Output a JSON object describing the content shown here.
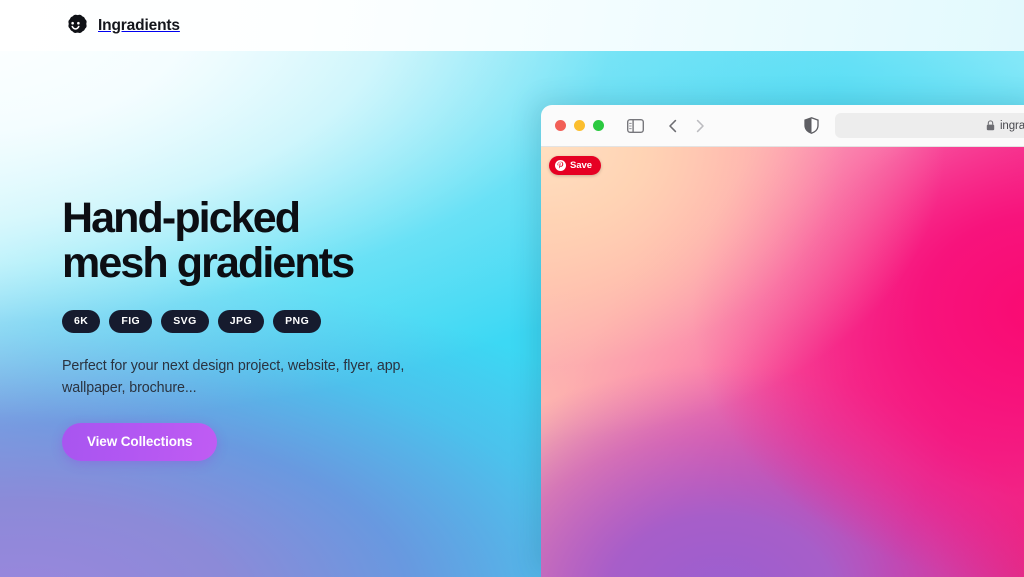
{
  "navbar": {
    "brand_name": "Ingradients",
    "logo_icon": "scalloped-square-smiley-logo"
  },
  "hero": {
    "title_line1": "Hand-picked",
    "title_line2": "mesh gradients",
    "badges": [
      "6K",
      "FIG",
      "SVG",
      "JPG",
      "PNG"
    ],
    "subtitle": "Perfect for your next design project, website, flyer, app, wallpaper, brochure...",
    "cta_label": "View Collections"
  },
  "browser": {
    "traffic_lights": {
      "close": "close-window-light",
      "minimize": "minimize-window-light",
      "zoom": "zoom-window-light"
    },
    "sidebar_toggle_icon": "sidebar-toggle-icon",
    "back_icon": "chevron-left-icon",
    "forward_icon": "chevron-right-icon",
    "shield_icon": "privacy-shield-icon",
    "address_bar": {
      "lock_icon": "lock-icon",
      "url": "ingradie"
    },
    "pinterest_save": {
      "label": "Save",
      "icon": "pinterest-icon"
    }
  },
  "colors": {
    "hero_cyan": "#3fd5f2",
    "hero_purple": "#8c8ad8",
    "hero_white": "#eefcff",
    "badge_bg": "#161b2e",
    "cta_purple": "#b257f2",
    "canvas_pink": "#f63692",
    "canvas_peach": "#ffd3b4",
    "canvas_violet": "#a75ec9",
    "pinterest_red": "#e60023",
    "title_color": "#0c0e13"
  }
}
